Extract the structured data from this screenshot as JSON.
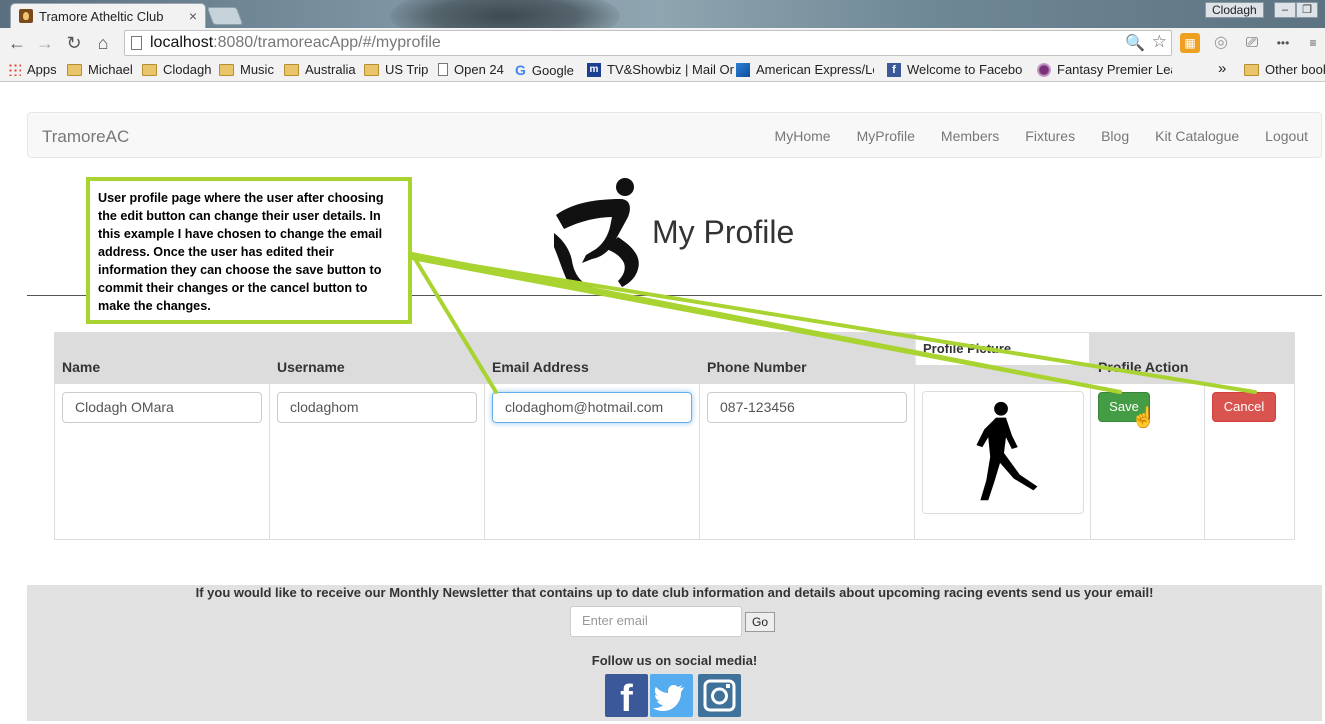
{
  "browser": {
    "tab_title": "Tramore Atheltic Club",
    "tab_close": "×",
    "window_user": "Clodagh",
    "url_host": "localhost",
    "url_path": ":8080/tramoreacApp/#/myprofile",
    "bookmarks": [
      {
        "label": "Apps",
        "icon": "apps-icon"
      },
      {
        "label": "Michael",
        "icon": "folder-icon"
      },
      {
        "label": "Clodagh",
        "icon": "folder-icon"
      },
      {
        "label": "Music",
        "icon": "folder-icon"
      },
      {
        "label": "Australia",
        "icon": "folder-icon"
      },
      {
        "label": "US Trip",
        "icon": "folder-icon"
      },
      {
        "label": "Open 24",
        "icon": "page-icon"
      },
      {
        "label": "Google",
        "icon": "google-icon"
      },
      {
        "label": "TV&Showbiz | Mail Or",
        "icon": "mailonline-icon"
      },
      {
        "label": "American Express/Log",
        "icon": "amex-icon"
      },
      {
        "label": "Welcome to Facebook",
        "icon": "facebook-icon"
      },
      {
        "label": "Fantasy Premier Leag",
        "icon": "fpl-icon"
      }
    ],
    "bookmarks_overflow": "»",
    "other_bookmarks": "Other book"
  },
  "navbar": {
    "brand": "TramoreAC",
    "links": [
      "MyHome",
      "MyProfile",
      "Members",
      "Fixtures",
      "Blog",
      "Kit Catalogue",
      "Logout"
    ]
  },
  "page": {
    "title": "My Profile"
  },
  "annotation": {
    "text": "User profile page where the user after choosing the edit button can change their user details. In this example I have chosen to change the email address. Once the user has edited their information they can choose the save button to commit their changes or the cancel button to make the changes.",
    "color": "#a8d331"
  },
  "profile_table": {
    "headers": {
      "name": "Name",
      "username": "Username",
      "email": "Email Address",
      "phone": "Phone Number",
      "picture": "Profile Picture",
      "action": "Profile Action"
    },
    "values": {
      "name": "Clodagh OMara",
      "username": "clodaghom",
      "email": "clodaghom@hotmail.com",
      "phone": "087-123456"
    },
    "save_label": "Save",
    "cancel_label": "Cancel"
  },
  "footer": {
    "newsletter_text": "If you would like to receive our Monthly Newsletter that contains up to date club information and details about upcoming racing events send us your email!",
    "email_placeholder": "Enter email",
    "go_label": "Go",
    "follow_text": "Follow us on social media!",
    "social": [
      "facebook",
      "twitter",
      "instagram"
    ]
  },
  "colors": {
    "save": "#449d44",
    "cancel": "#d9534f",
    "annotation": "#a8d331"
  }
}
